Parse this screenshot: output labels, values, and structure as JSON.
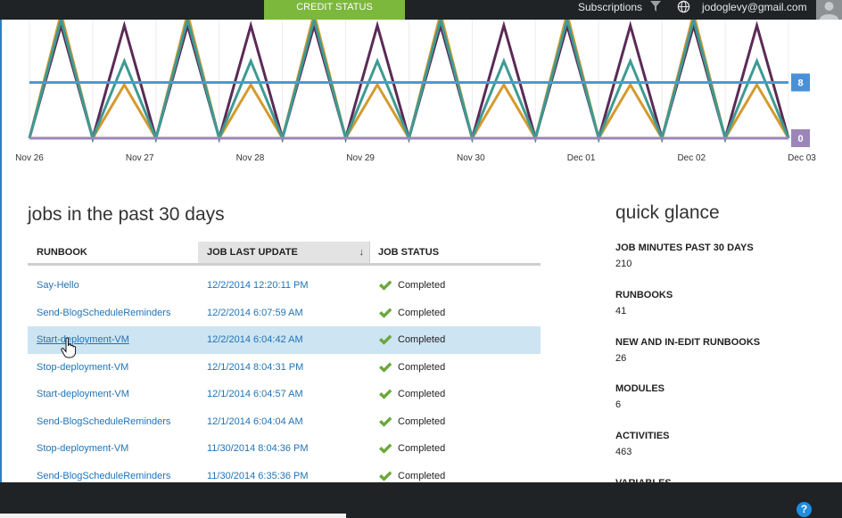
{
  "topbar": {
    "credit_status": "CREDIT STATUS",
    "subscriptions": "Subscriptions",
    "filter_icon": "filter-icon",
    "globe_icon": "globe-icon",
    "user_email": "jodoglevy@gmail.com",
    "avatar_icon": "user-avatar-icon"
  },
  "chart_data": {
    "type": "line",
    "categories": [
      "Nov 26",
      "Nov 27",
      "Nov 28",
      "Nov 29",
      "Nov 30",
      "Dec 01",
      "Dec 02",
      "Dec 03"
    ],
    "series": [
      {
        "color": "#5b2a56",
        "values": [
          0,
          0.95,
          0,
          0.95,
          0,
          0.95,
          0,
          0.95,
          0,
          0.95,
          0,
          0.95,
          0,
          0.95,
          0,
          0.95,
          0,
          0.95,
          0,
          0.95,
          0,
          0.95,
          0,
          0.95,
          0
        ]
      },
      {
        "color": "#d49a2d",
        "values": [
          0,
          1.05,
          0,
          0.45,
          0,
          1.05,
          0,
          0.45,
          0,
          1.05,
          0,
          0.45,
          0,
          1.05,
          0,
          0.45,
          0,
          1.05,
          0,
          0.45,
          0,
          1.05,
          0,
          0.45,
          0
        ]
      },
      {
        "color": "#3e9a93",
        "values": [
          0,
          1.0,
          0,
          0.65,
          0,
          1.0,
          0,
          0.65,
          0,
          1.0,
          0,
          0.65,
          0,
          1.0,
          0,
          0.65,
          0,
          1.0,
          0,
          0.65,
          0,
          1.0,
          0,
          0.65,
          0
        ]
      },
      {
        "color": "#4a9ad6",
        "values": [
          0.47,
          0.47,
          0.47,
          0.47,
          0.47,
          0.47,
          0.47,
          0.47,
          0.47,
          0.47,
          0.47,
          0.47,
          0.47,
          0.47,
          0.47,
          0.47,
          0.47,
          0.47,
          0.47,
          0.47,
          0.47,
          0.47,
          0.47,
          0.47,
          0.47
        ],
        "end_label": "8",
        "end_label_color": "#4a90d9"
      },
      {
        "color": "#9c86b8",
        "values": [
          0,
          0,
          0,
          0,
          0,
          0,
          0,
          0,
          0,
          0,
          0,
          0,
          0,
          0,
          0,
          0,
          0,
          0,
          0,
          0,
          0,
          0,
          0,
          0,
          0
        ],
        "end_label": "0",
        "end_label_color": "#9c86b8"
      }
    ]
  },
  "jobs": {
    "title": "jobs in the past 30 days",
    "columns": [
      "RUNBOOK",
      "JOB LAST UPDATE",
      "JOB STATUS"
    ],
    "sort_icon": "sort-down-arrow-icon",
    "rows": [
      {
        "runbook": "Say-Hello",
        "updated": "12/2/2014 12:20:11 PM",
        "status": "Completed",
        "selected": false
      },
      {
        "runbook": "Send-BlogScheduleReminders",
        "updated": "12/2/2014 6:07:59 AM",
        "status": "Completed",
        "selected": false
      },
      {
        "runbook": "Start-deployment-VM",
        "updated": "12/2/2014 6:04:42 AM",
        "status": "Completed",
        "selected": true
      },
      {
        "runbook": "Stop-deployment-VM",
        "updated": "12/1/2014 8:04:31 PM",
        "status": "Completed",
        "selected": false
      },
      {
        "runbook": "Start-deployment-VM",
        "updated": "12/1/2014 6:04:57 AM",
        "status": "Completed",
        "selected": false
      },
      {
        "runbook": "Send-BlogScheduleReminders",
        "updated": "12/1/2014 6:04:04 AM",
        "status": "Completed",
        "selected": false
      },
      {
        "runbook": "Stop-deployment-VM",
        "updated": "11/30/2014 8:04:36 PM",
        "status": "Completed",
        "selected": false
      },
      {
        "runbook": "Send-BlogScheduleReminders",
        "updated": "11/30/2014 6:35:36 PM",
        "status": "Completed",
        "selected": false
      }
    ],
    "status_icon": "checkmark-icon",
    "status_color": "#6aa83a"
  },
  "quick_glance": {
    "title": "quick glance",
    "items": [
      {
        "label": "JOB MINUTES PAST 30 DAYS",
        "value": "210"
      },
      {
        "label": "RUNBOOKS",
        "value": "41"
      },
      {
        "label": "NEW AND IN-EDIT RUNBOOKS",
        "value": "26"
      },
      {
        "label": "MODULES",
        "value": "6"
      },
      {
        "label": "ACTIVITIES",
        "value": "463"
      },
      {
        "label": "VARIABLES",
        "value": ""
      }
    ]
  },
  "footer": {
    "help_label": "?",
    "help_icon": "help-icon"
  }
}
